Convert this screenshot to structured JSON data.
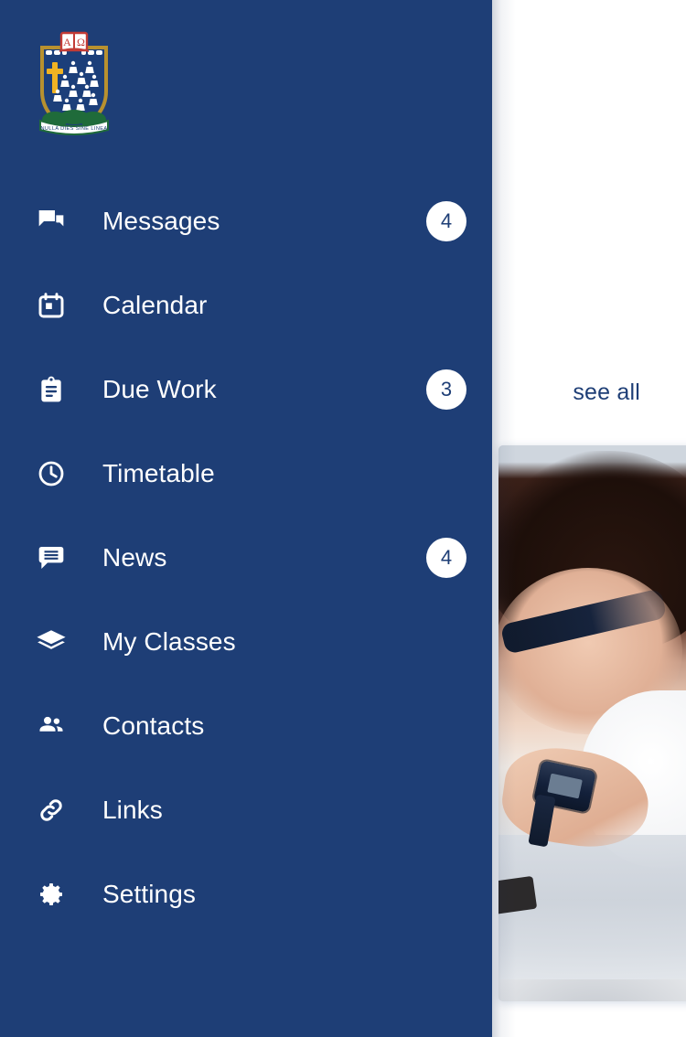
{
  "theme": {
    "drawer_bg": "#1e3e76",
    "drawer_text": "#ffffff",
    "badge_bg": "#ffffff",
    "badge_text": "#1e3e76",
    "link_color": "#1e3e76",
    "page_bg": "#ffffff"
  },
  "crest": {
    "name": "school-crest",
    "motto": "NULLA DIES SINE LINEA",
    "book_left_letter": "A",
    "book_right_letter": "Ω"
  },
  "page": {
    "see_all_label": "see all",
    "photo_caption": ""
  },
  "drawer": {
    "items": [
      {
        "label": "Messages",
        "icon": "chat-bubbles-icon",
        "badge": "4"
      },
      {
        "label": "Calendar",
        "icon": "calendar-icon",
        "badge": ""
      },
      {
        "label": "Due Work",
        "icon": "clipboard-icon",
        "badge": "3"
      },
      {
        "label": "Timetable",
        "icon": "clock-icon",
        "badge": ""
      },
      {
        "label": "News",
        "icon": "article-bubble-icon",
        "badge": "4"
      },
      {
        "label": "My Classes",
        "icon": "graduation-cap-icon",
        "badge": ""
      },
      {
        "label": "Contacts",
        "icon": "people-icon",
        "badge": ""
      },
      {
        "label": "Links",
        "icon": "link-icon",
        "badge": ""
      },
      {
        "label": "Settings",
        "icon": "gear-icon",
        "badge": ""
      }
    ]
  }
}
